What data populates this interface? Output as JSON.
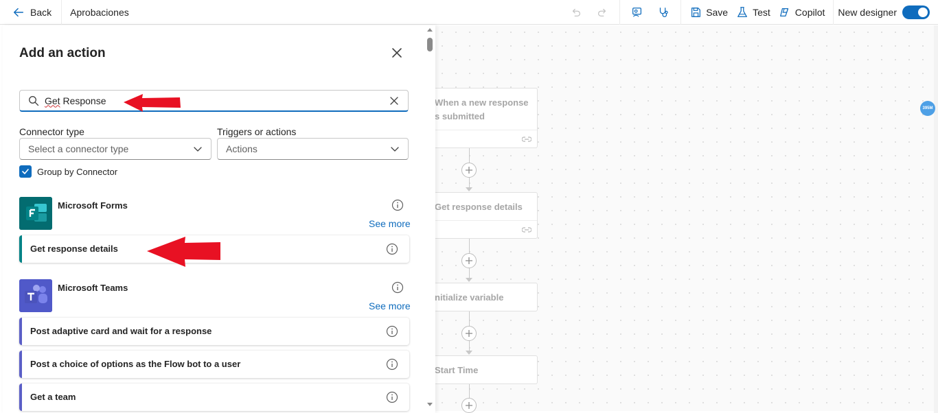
{
  "topbar": {
    "back_label": "Back",
    "flow_name": "Aprobaciones",
    "save_label": "Save",
    "test_label": "Test",
    "copilot_label": "Copilot",
    "new_designer_label": "New designer",
    "new_designer_on": true
  },
  "panel": {
    "title": "Add an action",
    "search": {
      "value_part1": "Get",
      "value_part2": " Response"
    },
    "connector_type": {
      "label": "Connector type",
      "placeholder": "Select a connector type"
    },
    "triggers_actions": {
      "label": "Triggers or actions",
      "value": "Actions"
    },
    "group_by_connector": {
      "label": "Group by Connector",
      "checked": true
    },
    "connectors": [
      {
        "name": "Microsoft Forms",
        "see_more": "See more",
        "icon": "microsoft-forms-icon",
        "color": "#036c70",
        "actions": [
          "Get response details"
        ]
      },
      {
        "name": "Microsoft Teams",
        "see_more": "See more",
        "icon": "microsoft-teams-icon",
        "color": "#5059c9",
        "actions": [
          "Post adaptive card and wait for a response",
          "Post a choice of options as the Flow bot to a user",
          "Get a team"
        ]
      }
    ]
  },
  "canvas": {
    "nodes": [
      {
        "line1": "When a new response",
        "line2": "s submitted"
      },
      {
        "line1": "Get response details"
      },
      {
        "line1": "nitialize variable"
      },
      {
        "line1": "Start Time"
      }
    ],
    "badge": "395M"
  },
  "colors": {
    "accent": "#0f6cbd",
    "forms_stripe": "#038387",
    "teams_stripe": "#5b5fc7",
    "annotation_arrow": "#e81123"
  }
}
